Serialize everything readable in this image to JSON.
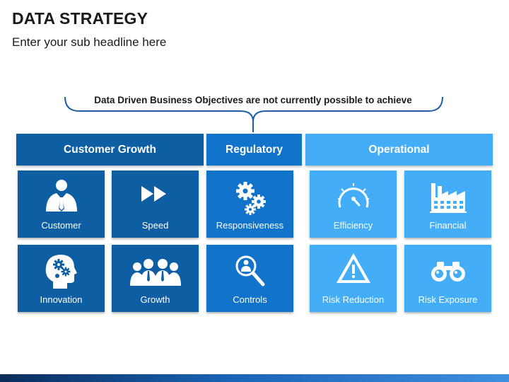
{
  "page": {
    "title": "DATA STRATEGY",
    "subtitle": "Enter your sub headline here",
    "objective": "Data Driven Business Objectives are not currently possible to achieve"
  },
  "colors": {
    "dark_blue": "#0e5ea4",
    "mid_blue": "#1173c9",
    "light_blue": "#43aef7",
    "brace": "#1f5fa6"
  },
  "categories": [
    {
      "label": "Customer Growth",
      "color": "#0e5ea4"
    },
    {
      "label": "Regulatory",
      "color": "#1173c9"
    },
    {
      "label": "Operational",
      "color": "#43aef7"
    }
  ],
  "tiles": [
    {
      "label": "Customer",
      "icon": "businessman-icon"
    },
    {
      "label": "Speed",
      "icon": "fast-forward-icon"
    },
    {
      "label": "Responsiveness",
      "icon": "gears-icon"
    },
    {
      "label": "Efficiency",
      "icon": "speedometer-icon"
    },
    {
      "label": "Financial",
      "icon": "factory-icon"
    },
    {
      "label": "Innovation",
      "icon": "head-gears-icon"
    },
    {
      "label": "Growth",
      "icon": "team-icon"
    },
    {
      "label": "Controls",
      "icon": "magnifier-person-icon"
    },
    {
      "label": "Risk Reduction",
      "icon": "warning-icon"
    },
    {
      "label": "Risk Exposure",
      "icon": "binoculars-icon"
    }
  ]
}
